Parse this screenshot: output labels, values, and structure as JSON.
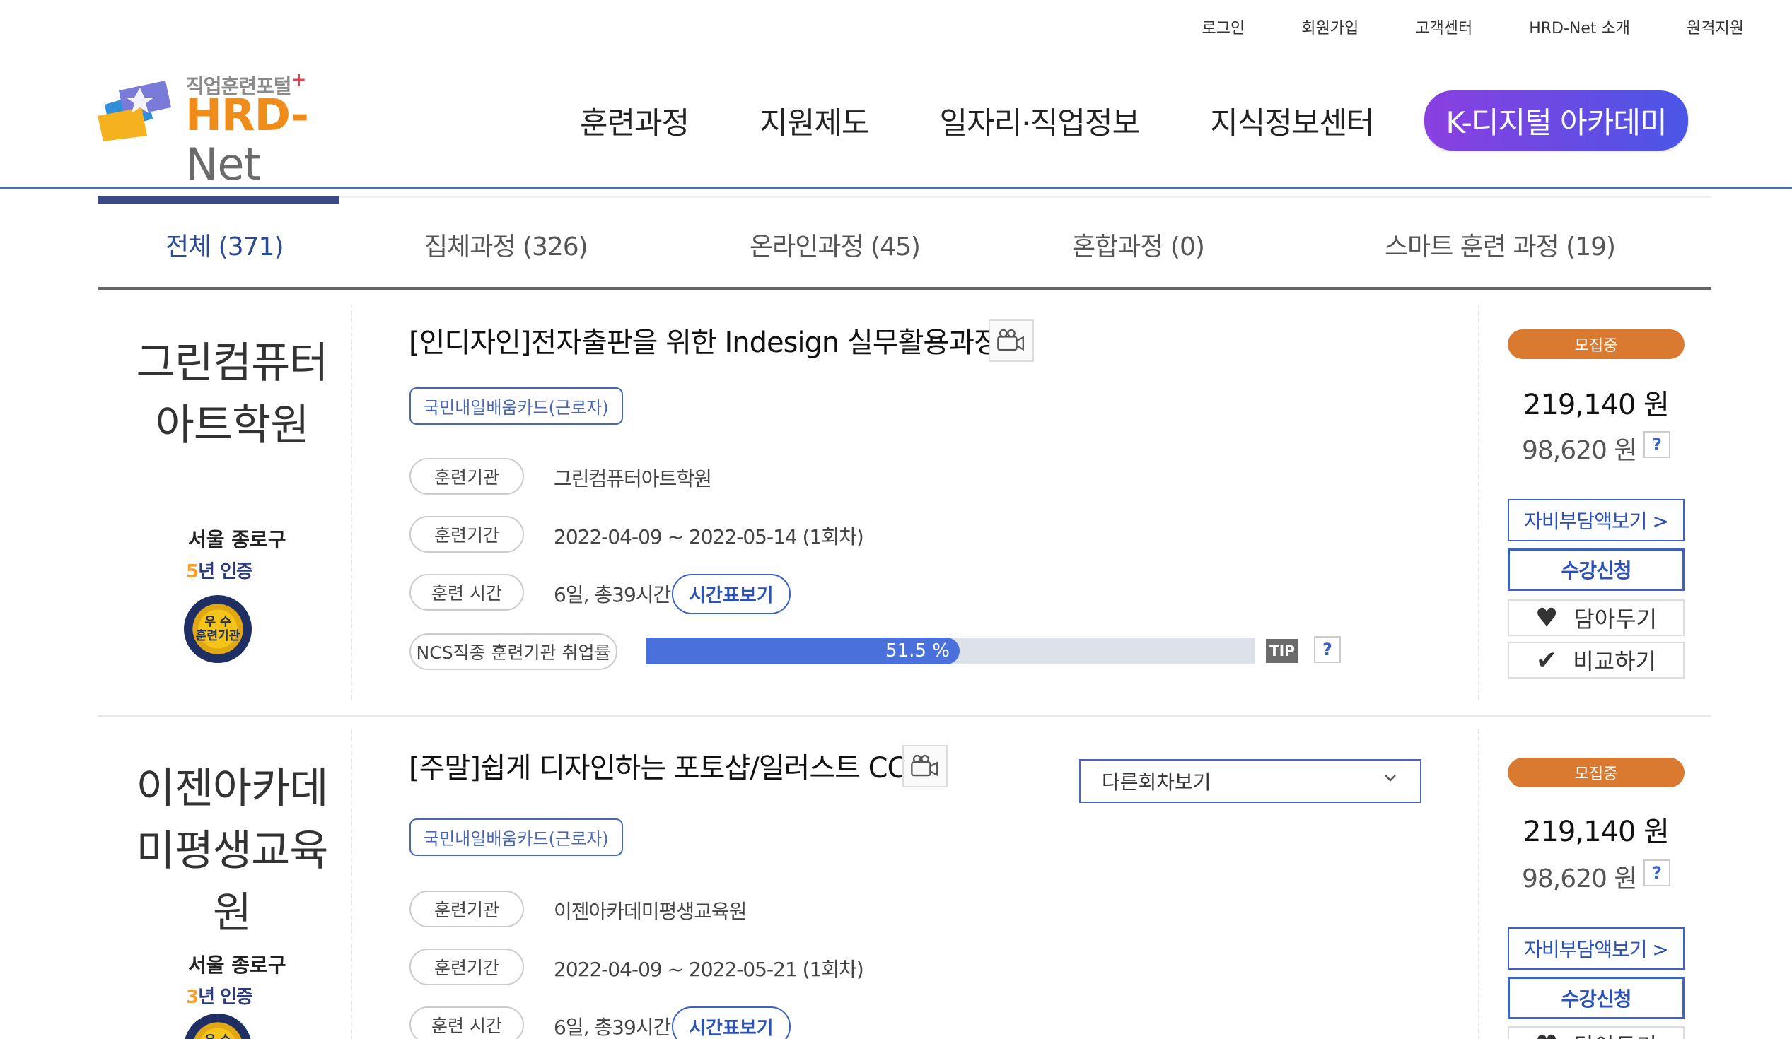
{
  "util_nav": [
    "로그인",
    "회원가입",
    "고객센터",
    "HRD-Net 소개",
    "원격지원"
  ],
  "logo": {
    "sub": "직업훈련포털",
    "plus": "+",
    "main_a": "HRD",
    "main_dash": "-",
    "main_b": "Net"
  },
  "gnb": {
    "items": [
      "훈련과정",
      "지원제도",
      "일자리·직업정보",
      "지식정보센터"
    ],
    "highlight": "K-디지털 아카데미"
  },
  "tabs": [
    {
      "label": "전체 (371)",
      "active": true
    },
    {
      "label": "집체과정 (326)",
      "active": false
    },
    {
      "label": "온라인과정 (45)",
      "active": false
    },
    {
      "label": "혼합과정 (0)",
      "active": false
    },
    {
      "label": "스마트 훈련 과정 (19)",
      "active": false
    }
  ],
  "labels": {
    "institution": "훈련기관",
    "period": "훈련기간",
    "time": "훈련 시간",
    "ncs": "NCS직종 훈련기관 취업률",
    "timetable_btn": "시간표보기",
    "tip": "TIP",
    "question": "?",
    "self_pay_btn": "자비부담액보기 >",
    "apply_btn": "수강신청",
    "wish_btn": "담아두기",
    "compare_btn": "비교하기",
    "other_rounds": "다른회차보기",
    "badge_card": "국민내일배움카드(근로자)",
    "medal_text": "우 수\n훈련기관"
  },
  "icons": {
    "video": "video-camera-icon",
    "heart": "heart-icon",
    "check": "check-icon",
    "chevron": "chevron-down-icon"
  },
  "colors": {
    "accent_blue": "#3b62c4",
    "status_orange": "#d97a30",
    "k_academy_from": "#8a3fe0",
    "k_academy_to": "#4a56e6"
  },
  "courses": [
    {
      "institution_name_lines": [
        "그린컴퓨터",
        "아트학원"
      ],
      "region": "서울 종로구",
      "cert_num": "5",
      "cert_text": "년 인증",
      "title": "[인디자인]전자출판을 위한 Indesign 실무활용과정",
      "institution": "그린컴퓨터아트학원",
      "period": "2022-04-09 ~ 2022-05-14 (1회차)",
      "time": "6일, 총39시간",
      "employment_rate": 51.5,
      "employment_rate_text": "51.5 %",
      "status": "모집중",
      "price": "219,140 원",
      "price_sub": "98,620 원"
    },
    {
      "institution_name_lines": [
        "이젠아카데",
        "미평생교육",
        "원"
      ],
      "region": "서울 종로구",
      "cert_num": "3",
      "cert_text": "년 인증",
      "title": "[주말]쉽게 디자인하는 포토샵/일러스트 CC",
      "institution": "이젠아카데미평생교육원",
      "period": "2022-04-09 ~ 2022-05-21 (1회차)",
      "time": "6일, 총39시간",
      "status": "모집중",
      "price": "219,140 원",
      "price_sub": "98,620 원"
    }
  ]
}
